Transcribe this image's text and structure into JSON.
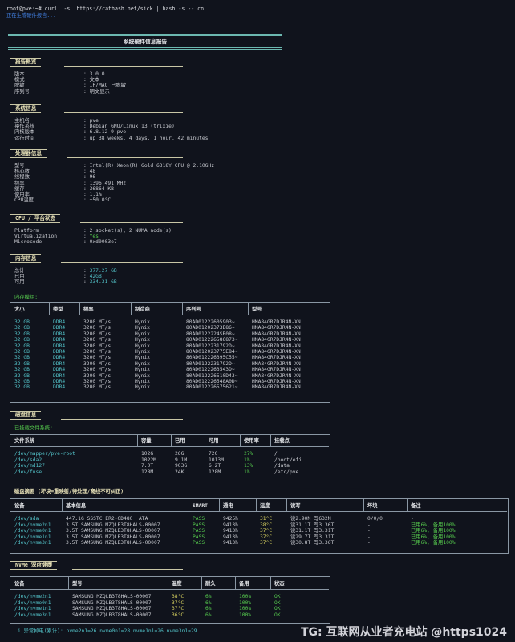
{
  "terminal": {
    "command": "root@pve:~# curl  -sL https://cathash.net/sick | bash -s -- cn",
    "status_line": "正在生成硬件报告..."
  },
  "report_title": "系统硬件信息报告",
  "sections": {
    "report_overview": {
      "title": "报告概览",
      "rows": [
        {
          "key": "版本",
          "value": "3.0.0"
        },
        {
          "key": "模式",
          "value": "文本"
        },
        {
          "key": "脱敏",
          "value": "IP/MAC 已脱敏"
        },
        {
          "key": "序列号",
          "value": "明文显示"
        }
      ]
    },
    "system_info": {
      "title": "系统信息",
      "rows": [
        {
          "key": "主机名",
          "value": "pve"
        },
        {
          "key": "操作系统",
          "value": "Debian GNU/Linux 13 (trixie)"
        },
        {
          "key": "内核版本",
          "value": "6.8.12-9-pve"
        },
        {
          "key": "运行时间",
          "value": "up 38 weeks, 4 days, 1 hour, 42 minutes"
        }
      ]
    },
    "cpu_info": {
      "title": "处理器信息",
      "rows": [
        {
          "key": "型号",
          "value": "Intel(R) Xeon(R) Gold 6318Y CPU @ 2.10GHz"
        },
        {
          "key": "核心数",
          "value": "48"
        },
        {
          "key": "线程数",
          "value": "96"
        },
        {
          "key": "频率",
          "value": "1396.491 MHz"
        },
        {
          "key": "缓存",
          "value": "36864 KB"
        },
        {
          "key": "使用率",
          "value": "1.1%"
        },
        {
          "key": "CPU温度",
          "value": "+50.0°C"
        }
      ]
    },
    "platform": {
      "title": "CPU / 平台状态",
      "rows": [
        {
          "key": "Platform",
          "value": "2 socket(s), 2 NUMA node(s)"
        },
        {
          "key": "Virtualization",
          "value": "Yes"
        },
        {
          "key": "Microcode",
          "value": "0xd0003e7"
        }
      ]
    },
    "memory": {
      "title": "内存信息",
      "rows": [
        {
          "key": "总计",
          "value": "377.27 GB"
        },
        {
          "key": "已用",
          "value": "42GB"
        },
        {
          "key": "可用",
          "value": "334.31 GB"
        }
      ],
      "modules_label": "内存模组:",
      "columns": [
        "大小",
        "类型",
        "频率",
        "制造商",
        "序列号",
        "型号"
      ],
      "modules": [
        [
          "32 GB",
          "DDR4",
          "3200 MT/s",
          "Hynix",
          "80AD01222605903~",
          "HMA84GR7DJR4N-XN"
        ],
        [
          "32 GB",
          "DDR4",
          "3200 MT/s",
          "Hynix",
          "80AD01202373E86~",
          "HMA84GR7DJR4N-XN"
        ],
        [
          "32 GB",
          "DDR4",
          "3200 MT/s",
          "Hynix",
          "80AD0122224SB08~",
          "HMA84GR7DJR4N-XN"
        ],
        [
          "32 GB",
          "DDR4",
          "3200 MT/s",
          "Hynix",
          "80AD012226586873~",
          "HMA84GR7DJR4N-XN"
        ],
        [
          "32 GB",
          "DDR4",
          "3200 MT/s",
          "Hynix",
          "80AD0122231792D~",
          "HMA84GR7DJR4N-XN"
        ],
        [
          "32 GB",
          "DDR4",
          "3200 MT/s",
          "Hynix",
          "80AD012023775E84~",
          "HMA84GR7DJR4N-XN"
        ],
        [
          "32 GB",
          "DDR4",
          "3200 MT/s",
          "Hynix",
          "80AD012226395C55~",
          "HMA84GR7DJR4N-XN"
        ],
        [
          "32 GB",
          "DDR4",
          "3200 MT/s",
          "Hynix",
          "80AD0122231792D~",
          "HMA84GR7DJR4N-XN"
        ],
        [
          "32 GB",
          "DDR4",
          "3200 MT/s",
          "Hynix",
          "80AD0122263543D~",
          "HMA84GR7DJR4N-XN"
        ],
        [
          "32 GB",
          "DDR4",
          "3200 MT/s",
          "Hynix",
          "80AD012226510D43~",
          "HMA84GR7DJR4N-XN"
        ],
        [
          "32 GB",
          "DDR4",
          "3200 MT/s",
          "Hynix",
          "80AD012226548A0D~",
          "HMA84GR7DJR4N-XN"
        ],
        [
          "32 GB",
          "DDR4",
          "3200 MT/s",
          "Hynix",
          "80AD012226575621~",
          "HMA84GR7DJR4N-XN"
        ]
      ]
    },
    "disk": {
      "title": "磁盘信息",
      "mounted_label": "已挂载文件系统:",
      "columns": [
        "文件系统",
        "容量",
        "已用",
        "可用",
        "使用率",
        "挂载点"
      ],
      "rows": [
        [
          "/dev/mapper/pve-root",
          "102G",
          "26G",
          "72G",
          "27%",
          "/"
        ],
        [
          "/dev/sda2",
          "1022M",
          "9.1M",
          "1013M",
          "1%",
          "/boot/efi"
        ],
        [
          "/dev/md127",
          "7.0T",
          "903G",
          "6.2T",
          "13%",
          "/data"
        ],
        [
          "/dev/fuse",
          "128M",
          "24K",
          "128M",
          "1%",
          "/etc/pve"
        ]
      ]
    },
    "disk_summary": {
      "title": "磁盘摘要 (坏块=重映射/待处理/离线不可纠正)",
      "columns": [
        "设备",
        "基本信息",
        "SMART",
        "通电",
        "温度",
        "读写",
        "坏块",
        "备注"
      ],
      "rows": [
        [
          "/dev/sda",
          "447.1G SSSTC ER2-GD480",
          "ATA",
          "PASS",
          "9425h",
          "31°C",
          "读2.90M 写632M",
          "0/0/0",
          "-"
        ],
        [
          "/dev/nvme2n1",
          "3.5T SAMSUNG MZQLB3T8HALS-00007",
          "",
          "PASS",
          "9413h",
          "38°C",
          "读31.1T 写3.36T",
          "-",
          "已用6%, 备用100%"
        ],
        [
          "/dev/nvme0n1",
          "3.5T SAMSUNG MZQLB3T8HALS-00007",
          "",
          "PASS",
          "9413h",
          "37°C",
          "读31.1T 写3.31T",
          "-",
          "已用6%, 备用100%"
        ],
        [
          "/dev/nvme1n1",
          "3.5T SAMSUNG MZQLB3T8HALS-00007",
          "",
          "PASS",
          "9413h",
          "37°C",
          "读29.7T 写3.31T",
          "-",
          "已用6%, 备用100%"
        ],
        [
          "/dev/nvme3n1",
          "3.5T SAMSUNG MZQLB3T8HALS-00007",
          "",
          "PASS",
          "9413h",
          "37°C",
          "读30.8T 写3.36T",
          "-",
          "已用6%, 备用100%"
        ]
      ]
    },
    "nvme_health": {
      "title": "NVMe 深度健康",
      "columns": [
        "设备",
        "型号",
        "温度",
        "耐久",
        "备用",
        "状态"
      ],
      "rows": [
        [
          "/dev/nvme2n1",
          "SAMSUNG MZQLB3T8HALS-00007",
          "38°C",
          "6%",
          "100%",
          "OK"
        ],
        [
          "/dev/nvme0n1",
          "SAMSUNG MZQLB3T8HALS-00007",
          "37°C",
          "6%",
          "100%",
          "OK"
        ],
        [
          "/dev/nvme1n1",
          "SAMSUNG MZQLB3T8HALS-00007",
          "37°C",
          "6%",
          "100%",
          "OK"
        ],
        [
          "/dev/nvme3n1",
          "SAMSUNG MZQLB3T8HALS-00007",
          "36°C",
          "6%",
          "100%",
          "OK"
        ]
      ],
      "footnote": "i 异常掉电(累计): nvme2n1=26 nvme0n1=28 nvme1n1=26 nvme3n1=29"
    }
  },
  "watermark": "TG: 互联网从业者充电站 @https1024",
  "colors": {
    "background": "#10131c",
    "section_accent": "#c9c7a6",
    "ok_green": "#55c94d",
    "warn_yellow": "#d8d260",
    "info_cyan": "#53c3c9"
  }
}
